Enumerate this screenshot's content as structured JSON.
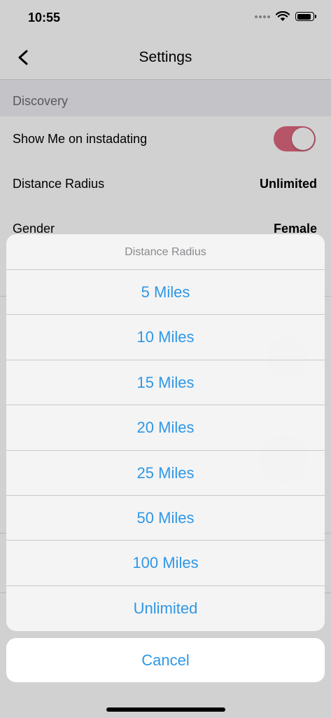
{
  "status_bar": {
    "time": "10:55"
  },
  "nav": {
    "title": "Settings"
  },
  "section": {
    "title": "Discovery"
  },
  "settings": {
    "show_me_label": "Show Me on instadating",
    "show_me_enabled": true,
    "distance_label": "Distance Radius",
    "distance_value": "Unlimited",
    "gender_label": "Gender",
    "gender_value": "Female"
  },
  "action_sheet": {
    "title": "Distance Radius",
    "options": [
      "5 Miles",
      "10 Miles",
      "15 Miles",
      "20 Miles",
      "25 Miles",
      "50 Miles",
      "100 Miles",
      "Unlimited"
    ],
    "cancel_label": "Cancel"
  },
  "colors": {
    "accent": "#2f97e6",
    "toggle_on": "#e0687f"
  }
}
